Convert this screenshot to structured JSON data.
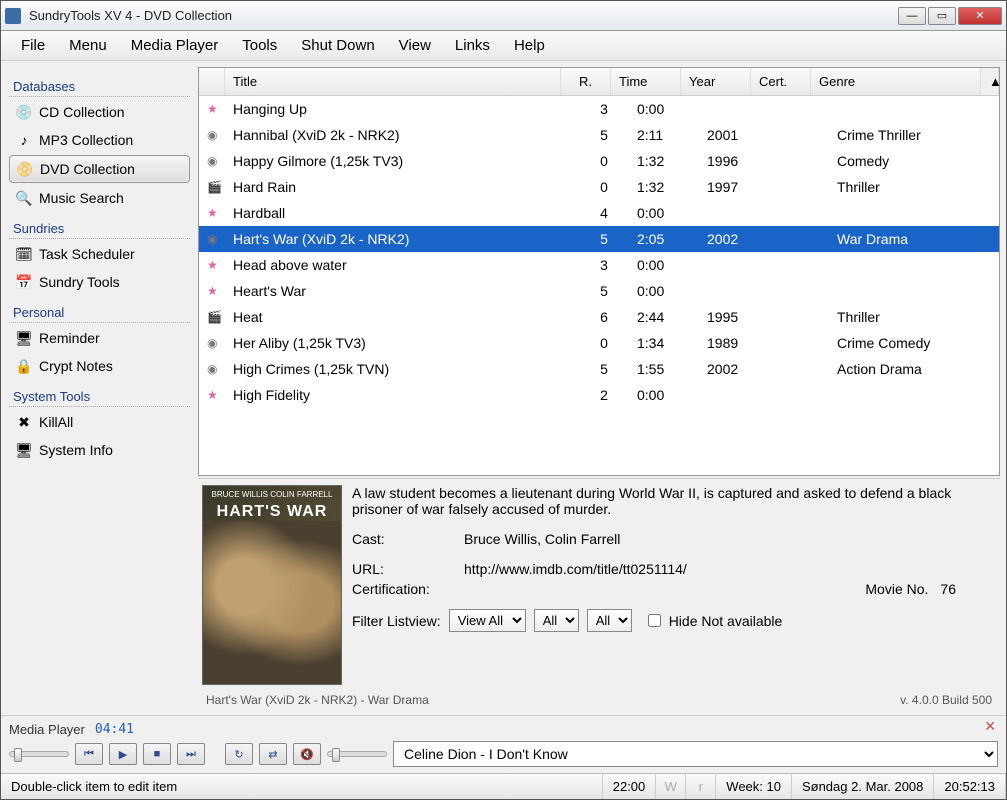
{
  "window": {
    "title": "SundryTools XV 4 - DVD Collection"
  },
  "menubar": [
    "File",
    "Menu",
    "Media Player",
    "Tools",
    "Shut Down",
    "View",
    "Links",
    "Help"
  ],
  "sidebar": {
    "sections": [
      {
        "header": "Databases",
        "items": [
          {
            "label": "CD Collection",
            "icon": "💿"
          },
          {
            "label": "MP3 Collection",
            "icon": "♪"
          },
          {
            "label": "DVD Collection",
            "icon": "📀",
            "active": true
          },
          {
            "label": "Music Search",
            "icon": "🔍"
          }
        ]
      },
      {
        "header": "Sundries",
        "items": [
          {
            "label": "Task Scheduler",
            "icon": "🗓"
          },
          {
            "label": "Sundry Tools",
            "icon": "📅"
          }
        ]
      },
      {
        "header": "Personal",
        "items": [
          {
            "label": "Reminder",
            "icon": "🖥"
          },
          {
            "label": "Crypt Notes",
            "icon": "🔒"
          }
        ]
      },
      {
        "header": "System Tools",
        "items": [
          {
            "label": "KillAll",
            "icon": "✖"
          },
          {
            "label": "System Info",
            "icon": "🖥"
          }
        ]
      }
    ]
  },
  "table": {
    "headers": {
      "title": "Title",
      "r": "R.",
      "time": "Time",
      "year": "Year",
      "cert": "Cert.",
      "genre": "Genre"
    },
    "rows": [
      {
        "icon": "star",
        "title": "Hanging Up",
        "r": "3",
        "time": "0:00",
        "year": "",
        "genre": ""
      },
      {
        "icon": "disc",
        "title": "Hannibal (XviD 2k - NRK2)",
        "r": "5",
        "time": "2:11",
        "year": "2001",
        "genre": "Crime Thriller"
      },
      {
        "icon": "disc",
        "title": "Happy Gilmore (1,25k TV3)",
        "r": "0",
        "time": "1:32",
        "year": "1996",
        "genre": "Comedy"
      },
      {
        "icon": "clap",
        "title": "Hard Rain",
        "r": "0",
        "time": "1:32",
        "year": "1997",
        "genre": "Thriller"
      },
      {
        "icon": "star",
        "title": "Hardball",
        "r": "4",
        "time": "0:00",
        "year": "",
        "genre": ""
      },
      {
        "icon": "disc",
        "title": "Hart's War (XviD 2k - NRK2)",
        "r": "5",
        "time": "2:05",
        "year": "2002",
        "genre": "War Drama",
        "selected": true
      },
      {
        "icon": "star",
        "title": "Head above water",
        "r": "3",
        "time": "0:00",
        "year": "",
        "genre": ""
      },
      {
        "icon": "star",
        "title": "Heart's War",
        "r": "5",
        "time": "0:00",
        "year": "",
        "genre": ""
      },
      {
        "icon": "clap",
        "title": "Heat",
        "r": "6",
        "time": "2:44",
        "year": "1995",
        "genre": "Thriller"
      },
      {
        "icon": "disc",
        "title": "Her Aliby (1,25k TV3)",
        "r": "0",
        "time": "1:34",
        "year": "1989",
        "genre": "Crime Comedy"
      },
      {
        "icon": "disc",
        "title": "High Crimes (1,25k TVN)",
        "r": "5",
        "time": "1:55",
        "year": "2002",
        "genre": "Action Drama"
      },
      {
        "icon": "star",
        "title": "High Fidelity",
        "r": "2",
        "time": "0:00",
        "year": "",
        "genre": ""
      }
    ]
  },
  "detail": {
    "poster_top": "BRUCE WILLIS    COLIN FARRELL",
    "poster_title": "HART'S WAR",
    "synopsis": "A law student becomes a lieutenant during World War II, is captured and asked to defend a black prisoner of war falsely accused of murder.",
    "cast_label": "Cast:",
    "cast": "Bruce Willis, Colin Farrell",
    "url_label": "URL:",
    "url": "http://www.imdb.com/title/tt0251114/",
    "cert_label": "Certification:",
    "movieno_label": "Movie No.",
    "movieno": "76",
    "filter_label": "Filter Listview:",
    "filter1": "View All",
    "filter2": "All",
    "filter3": "All",
    "hide_label": "Hide Not available",
    "status_left": "Hart's War (XviD 2k - NRK2) - War Drama",
    "status_right": "v. 4.0.0 Build 500"
  },
  "player": {
    "label": "Media Player",
    "time": "04:41",
    "track": "Celine Dion - I Don't Know"
  },
  "statusbar": {
    "hint": "Double-click item to edit item",
    "clock1": "22:00",
    "w": "W",
    "r": "r",
    "week": "Week: 10",
    "date": "Søndag 2. Mar. 2008",
    "clock2": "20:52:13"
  }
}
